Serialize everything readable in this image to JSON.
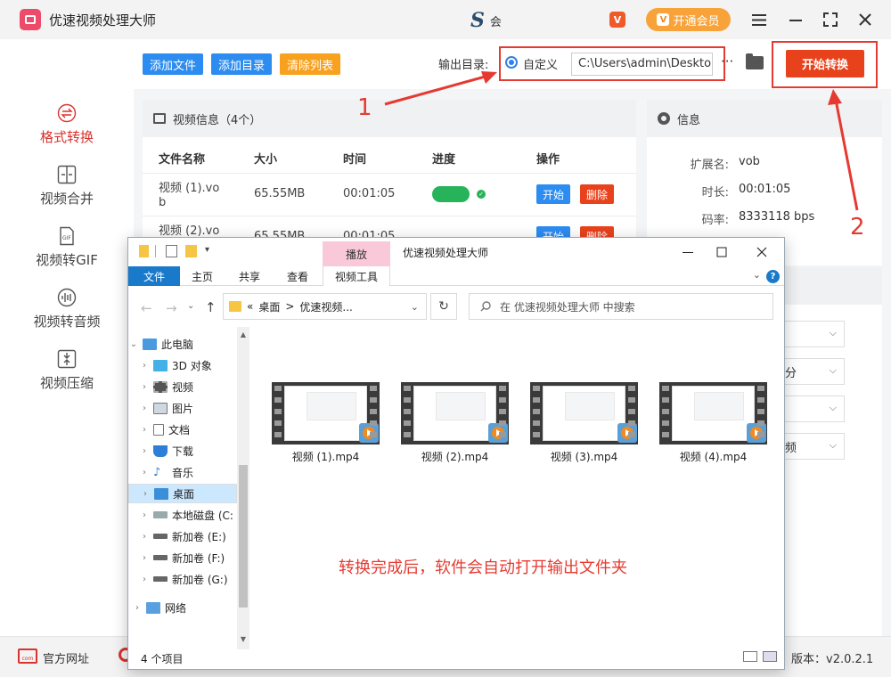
{
  "app": {
    "title": "优速视频处理大师",
    "user_name": "会",
    "vip_icon": "V",
    "vip_label": "开通会员",
    "vip_badge": "V"
  },
  "sidebar": {
    "items": [
      {
        "label": "格式转换",
        "icon": "format-convert-icon",
        "active": true
      },
      {
        "label": "视频合并",
        "icon": "merge-icon",
        "active": false
      },
      {
        "label": "视频转GIF",
        "icon": "gif-icon",
        "active": false
      },
      {
        "label": "视频转音频",
        "icon": "audio-icon",
        "active": false
      },
      {
        "label": "视频压缩",
        "icon": "compress-icon",
        "active": false
      }
    ]
  },
  "toolbar": {
    "add_file": "添加文件",
    "add_dir": "添加目录",
    "clear_list": "清除列表",
    "output_label": "输出目录:",
    "custom_label": "自定义",
    "output_path": "C:\\Users\\admin\\Deskto",
    "more": "···",
    "start": "开始转换"
  },
  "colors": {
    "add_btn": "#2d8cf0",
    "clear_btn": "#f8a11e",
    "start_btn": "#e8421c",
    "accent_red": "#d9322f",
    "progress": "#27b35a"
  },
  "video_panel": {
    "title": "视频信息（4个）",
    "columns": [
      "文件名称",
      "大小",
      "时间",
      "进度",
      "操作"
    ],
    "rows": [
      {
        "name_l1": "视频 (1).vo",
        "name_l2": "b",
        "size": "65.55MB",
        "time": "00:01:05",
        "start": "开始",
        "delete": "删除"
      },
      {
        "name_l1": "视频 (2).vo",
        "name_l2": "",
        "size": "65.55MB",
        "time": "00:01:05",
        "start": "开始",
        "delete": "删除"
      }
    ]
  },
  "info_panel": {
    "title": "信息",
    "ext_key": "扩展名:",
    "ext_val": "vob",
    "dur_key": "时长:",
    "dur_val": "00:01:05",
    "rate_key": "码率:",
    "rate_val": "8333118 bps"
  },
  "settings_partial": {
    "sel2": "分",
    "sel4": "频"
  },
  "annotations": {
    "num1": "1",
    "num2": "2"
  },
  "explorer": {
    "play_tab": "播放",
    "title": "优速视频处理大师",
    "ribbon": {
      "file": "文件",
      "home": "主页",
      "share": "共享",
      "view": "查看",
      "video_tools": "视频工具"
    },
    "breadcrumb_prefix": "«",
    "breadcrumb_1": "桌面",
    "breadcrumb_sep": ">",
    "breadcrumb_2": "优速视频...",
    "search_placeholder": "在 优速视频处理大师 中搜索",
    "tree": [
      {
        "label": "此电脑",
        "icon": "pc-icon"
      },
      {
        "label": "3D 对象",
        "icon": "3d-objects-icon"
      },
      {
        "label": "视频",
        "icon": "videos-folder-icon"
      },
      {
        "label": "图片",
        "icon": "pictures-folder-icon"
      },
      {
        "label": "文档",
        "icon": "documents-folder-icon"
      },
      {
        "label": "下载",
        "icon": "download-icon"
      },
      {
        "label": "音乐",
        "icon": "music-icon"
      },
      {
        "label": "桌面",
        "icon": "desktop-icon"
      },
      {
        "label": "本地磁盘 (C:",
        "icon": "local-disk-icon"
      },
      {
        "label": "新加卷 (E:)",
        "icon": "drive-icon"
      },
      {
        "label": "新加卷 (F:)",
        "icon": "drive-icon"
      },
      {
        "label": "新加卷 (G:)",
        "icon": "drive-icon"
      },
      {
        "label": "网络",
        "icon": "network-icon"
      }
    ],
    "files": [
      {
        "name": "视频 (1).mp4"
      },
      {
        "name": "视频 (2).mp4"
      },
      {
        "name": "视频 (3).mp4"
      },
      {
        "name": "视频 (4).mp4"
      }
    ],
    "notice": "转换完成后，软件会自动打开输出文件夹",
    "status": "4 个项目"
  },
  "footer": {
    "site_icon_text": "com",
    "site_label": "官方网址",
    "version": "版本：v2.0.2.1"
  }
}
